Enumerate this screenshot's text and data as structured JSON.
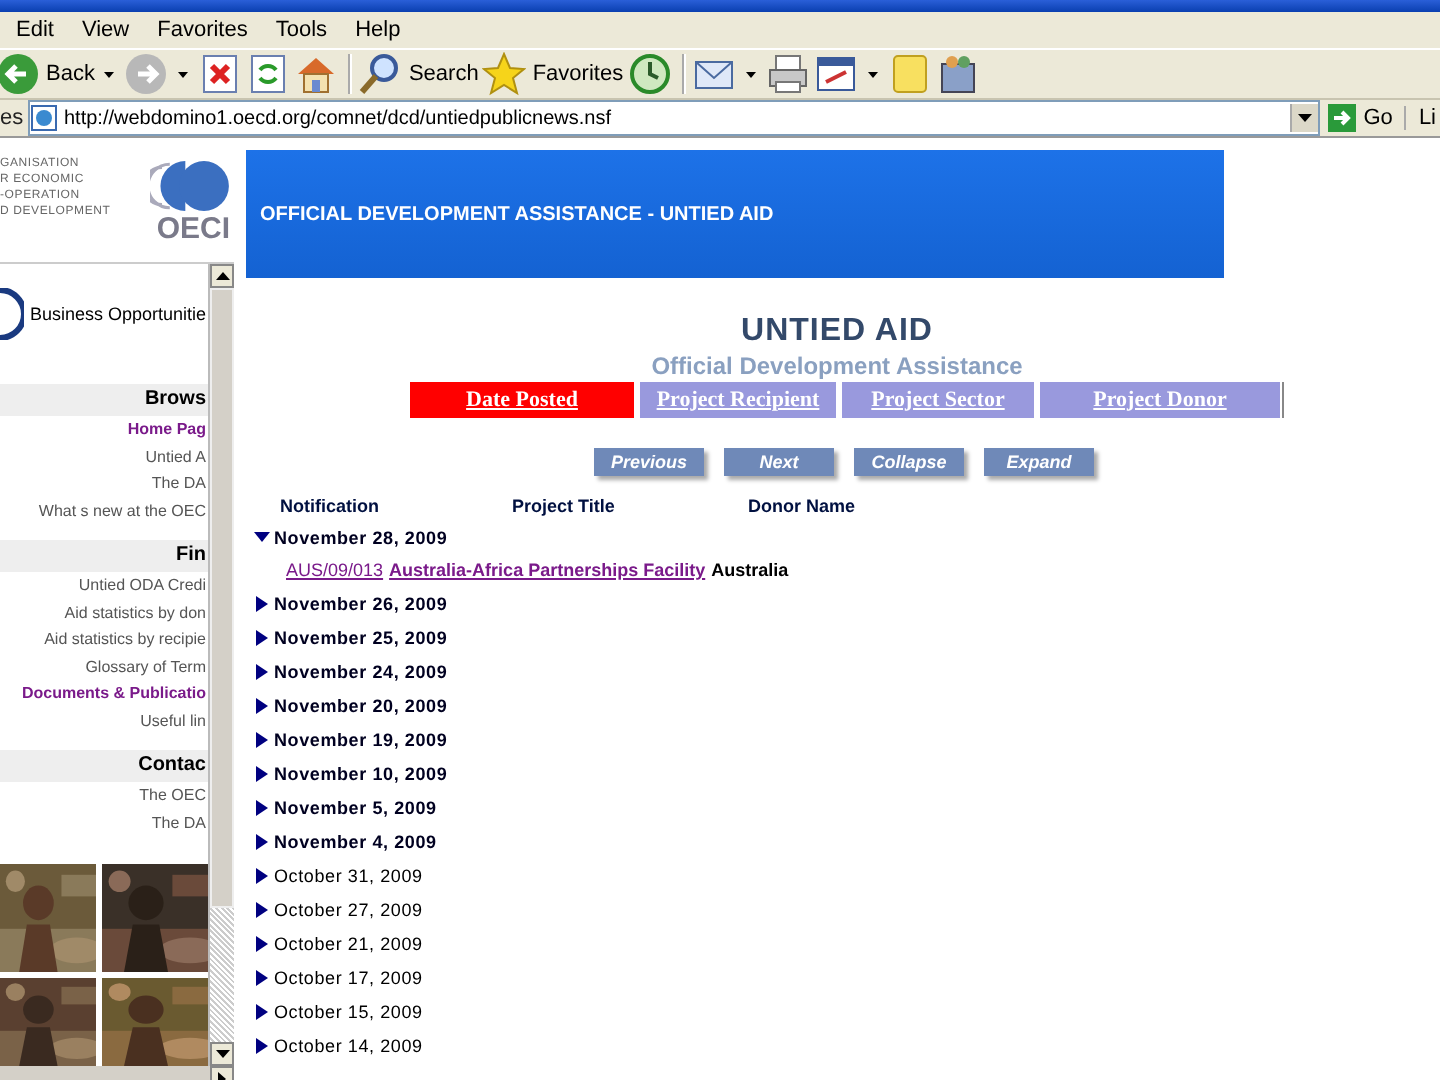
{
  "menu": [
    "Edit",
    "View",
    "Favorites",
    "Tools",
    "Help"
  ],
  "toolbar": [
    {
      "kind": "back",
      "label": "Back",
      "dropdown": true
    },
    {
      "kind": "forward",
      "dropdown": true
    },
    {
      "kind": "stop",
      "dropdown": false
    },
    {
      "kind": "refresh",
      "dropdown": false
    },
    {
      "kind": "home",
      "dropdown": false
    },
    {
      "kind": "separator"
    },
    {
      "kind": "search",
      "label": "Search",
      "dropdown": false
    },
    {
      "kind": "favorites",
      "label": "Favorites",
      "dropdown": false
    },
    {
      "kind": "history",
      "dropdown": false
    },
    {
      "kind": "separator"
    },
    {
      "kind": "mail",
      "dropdown": true
    },
    {
      "kind": "print",
      "dropdown": false
    },
    {
      "kind": "edit",
      "dropdown": true
    },
    {
      "kind": "note",
      "dropdown": false
    },
    {
      "kind": "messenger",
      "dropdown": false
    }
  ],
  "address_bar": {
    "label": "es",
    "url": "http://webdomino1.oecd.org/comnet/dcd/untiedpublicnews.nsf",
    "go": "Go",
    "links": "Li"
  },
  "logo": {
    "lines": [
      "GANISATION",
      "R ECONOMIC",
      "-OPERATION",
      "D DEVELOPMENT"
    ],
    "mark": "OECI"
  },
  "banner": {
    "title": "OFFICIAL DEVELOPMENT ASSISTANCE - UNTIED AID"
  },
  "sidebar": {
    "feature": "Business Opportunitie",
    "sections": [
      {
        "heading": "Brows",
        "items": [
          {
            "label": "Home Pag",
            "visited": true
          },
          {
            "label": "Untied A",
            "visited": false
          },
          {
            "label": "The DA",
            "visited": false
          },
          {
            "label": "What s new at the OEC",
            "visited": false
          }
        ]
      },
      {
        "heading": "Fin",
        "items": [
          {
            "label": "Untied ODA Credi",
            "visited": false
          },
          {
            "label": "Aid statistics by don",
            "visited": false
          },
          {
            "label": "Aid statistics by recipie",
            "visited": false
          },
          {
            "label": "Glossary of Term",
            "visited": false
          },
          {
            "label": "Documents & Publicatio",
            "visited": true
          },
          {
            "label": "Useful lin",
            "visited": false
          }
        ]
      },
      {
        "heading": "Contac",
        "items": [
          {
            "label": "The OEC",
            "visited": false
          },
          {
            "label": "The DA",
            "visited": false
          }
        ]
      }
    ]
  },
  "main": {
    "title": "UNTIED AID",
    "subtitle": "Official Development Assistance",
    "tabs": [
      {
        "label": "Date Posted",
        "selected": true
      },
      {
        "label": "Project Recipient",
        "selected": false
      },
      {
        "label": "Project Sector",
        "selected": false
      },
      {
        "label": "Project Donor",
        "selected": false
      }
    ],
    "buttons": [
      "Previous",
      "Next",
      "Collapse",
      "Expand"
    ],
    "columns": [
      "Notification",
      "Project Title",
      "Donor Name"
    ],
    "rows": [
      {
        "date": "November 28, 2009",
        "bold": true,
        "expanded": true,
        "children": [
          {
            "code": "AUS/09/013",
            "title": "Australia-Africa Partnerships Facility",
            "donor": "Australia"
          }
        ]
      },
      {
        "date": "November 26, 2009",
        "bold": true,
        "expanded": false
      },
      {
        "date": "November 25, 2009",
        "bold": true,
        "expanded": false
      },
      {
        "date": "November 24, 2009",
        "bold": true,
        "expanded": false
      },
      {
        "date": "November 20, 2009",
        "bold": true,
        "expanded": false
      },
      {
        "date": "November 19, 2009",
        "bold": true,
        "expanded": false
      },
      {
        "date": "November 10, 2009",
        "bold": true,
        "expanded": false
      },
      {
        "date": "November 5, 2009",
        "bold": true,
        "expanded": false
      },
      {
        "date": "November 4, 2009",
        "bold": true,
        "expanded": false
      },
      {
        "date": "October 31, 2009",
        "bold": false,
        "expanded": false
      },
      {
        "date": "October 27, 2009",
        "bold": false,
        "expanded": false
      },
      {
        "date": "October 21, 2009",
        "bold": false,
        "expanded": false
      },
      {
        "date": "October 17, 2009",
        "bold": false,
        "expanded": false
      },
      {
        "date": "October 15, 2009",
        "bold": false,
        "expanded": false
      },
      {
        "date": "October 14, 2009",
        "bold": false,
        "expanded": false
      }
    ]
  }
}
